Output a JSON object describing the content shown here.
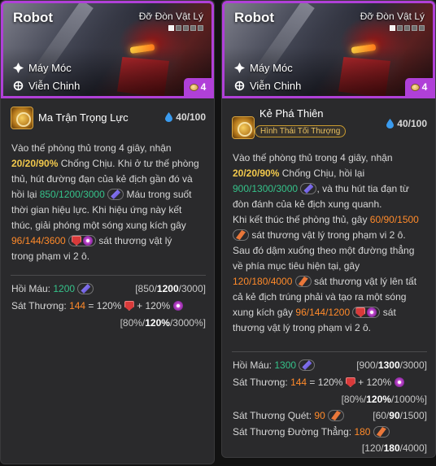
{
  "cards": [
    {
      "name": "Robot",
      "role": "Đỡ Đòn Vật Lý",
      "stars_on": 1,
      "stars_total": 5,
      "traits": [
        "Máy Móc",
        "Viễn Chinh"
      ],
      "cost": "4",
      "ability": {
        "name": "Ma Trận Trọng Lực",
        "mana": "40/100"
      },
      "description": {
        "l1": "Vào thế phòng thủ trong 4 giây, nhận",
        "l2_val": "20/20/90%",
        "l2_txt": " Chống Chịu. Khi ở tư thế phòng",
        "l3": "thủ, hút đường đạn của kẻ địch gần đó và",
        "l4_pre": "hồi lại ",
        "l4_val": "850/1200/3000",
        "l4_post": " Máu trong suốt",
        "l5": "thời gian hiệu lực. Khi hiệu ứng này kết",
        "l6": "thúc, giải phóng một sóng xung kích gây",
        "l7_val": "96/144/3600",
        "l7_post": " sát thương vật lý",
        "l8": "trong phạm vi 2 ô."
      },
      "stats": {
        "heal_label": "Hồi Máu:",
        "heal_val": "1200",
        "heal_r_pre": "[850/",
        "heal_r_b": "1200",
        "heal_r_post": "/3000]",
        "dmg_label": "Sát Thương:",
        "dmg_val": "144",
        "dmg_eq": " = 120%",
        "dmg_plus": " + 120%",
        "dmg_r_pre": "[80%/",
        "dmg_r_b": "120%",
        "dmg_r_post": "/3000%]"
      }
    },
    {
      "name": "Robot",
      "role": "Đỡ Đòn Vật Lý",
      "stars_on": 1,
      "stars_total": 5,
      "traits": [
        "Máy Móc",
        "Viễn Chinh"
      ],
      "cost": "4",
      "ability": {
        "name": "Kẻ Phá Thiên",
        "tag": "Hình Thái Tối Thượng",
        "mana": "40/100"
      },
      "description": {
        "l1": "Vào thế phòng thủ trong 4 giây, nhận",
        "l2_val": "20/20/90%",
        "l2_txt": " Chống Chịu, hồi lại",
        "l3_val": "900/1300/3000",
        "l3_post": ", và thu hút tia đạn từ",
        "l4": "đòn đánh của kẻ địch xung quanh.",
        "l5_pre": "Khi kết thúc thế phòng thủ, gây ",
        "l5_val": "60/90/1500",
        "l6_post": " sát thương vật lý trong phạm vi 2 ô.",
        "l7": "Sau đó dậm xuống theo một đường thẳng",
        "l8": "về phía mục tiêu hiện tại, gây",
        "l9_val": "120/180/4000",
        "l9_post": " sát thương vật lý lên tất",
        "l10": "cả kẻ địch trúng phải và tạo ra một sóng",
        "l11_pre": "xung kích gây ",
        "l11_val": "96/144/1200",
        "l11_post": " sát",
        "l12": "thương vật lý trong phạm vi 2 ô."
      },
      "stats": {
        "heal_label": "Hồi Máu:",
        "heal_val": "1300",
        "heal_r_pre": "[900/",
        "heal_r_b": "1300",
        "heal_r_post": "/3000]",
        "dmg_label": "Sát Thương:",
        "dmg_val": "144",
        "dmg_eq": " = 120%",
        "dmg_plus": " + 120%",
        "dmg_r_pre": "[80%/",
        "dmg_r_b": "120%",
        "dmg_r_post": "/1000%]",
        "sweep_label": "Sát Thương Quét:",
        "sweep_val": "90",
        "sweep_r_pre": "[60/",
        "sweep_r_b": "90",
        "sweep_r_post": "/1500]",
        "line_label": "Sát Thương Đường Thẳng:",
        "line_val": "180",
        "line_r_pre": "[120/",
        "line_r_b": "180",
        "line_r_post": "/4000]"
      }
    }
  ],
  "colors": {
    "border_purple": "#b040d8",
    "value_yellow": "#f2c94c",
    "value_green": "#35c28a",
    "value_orange": "#ff8a2a"
  },
  "icons": {
    "trait_1": "mech-icon",
    "trait_2": "expedition-icon",
    "mana": "mana-drop-icon",
    "cost": "coin-icon",
    "ability_power": "ability-power-icon",
    "attack_damage": "attack-damage-icon",
    "armor": "armor-icon",
    "magic_resist": "magic-resist-icon"
  }
}
